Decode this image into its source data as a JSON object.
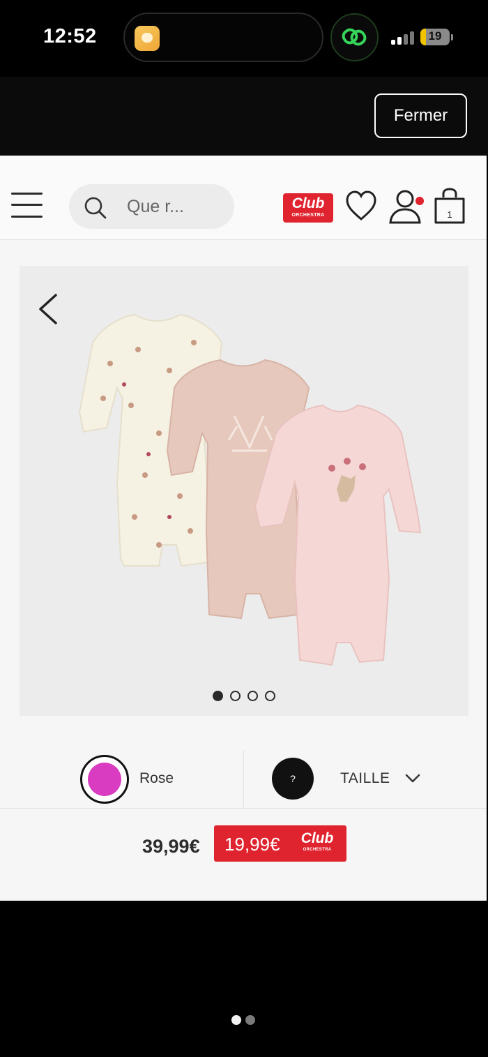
{
  "status_bar": {
    "time": "12:52",
    "battery_level": "19",
    "battery_fraction": 0.19
  },
  "overlay": {
    "close_label": "Fermer"
  },
  "header": {
    "search_placeholder": "Que r...",
    "club_logo_word": "Club",
    "club_logo_sub": "ORCHESTRA",
    "cart_count": "1",
    "brand_color": "#e0242f"
  },
  "gallery": {
    "image_count": 4,
    "active_index": 0,
    "background": "#ececec"
  },
  "options": {
    "color_label": "Rose",
    "color_swatch": "#d93cc0",
    "size_badge": "?",
    "size_label": "TAILLE"
  },
  "pricing": {
    "regular_price": "39,99€",
    "club_price": "19,99€",
    "club_word": "Club",
    "club_sub": "ORCHESTRA"
  },
  "pager": {
    "pages": 2,
    "active_index": 0
  }
}
